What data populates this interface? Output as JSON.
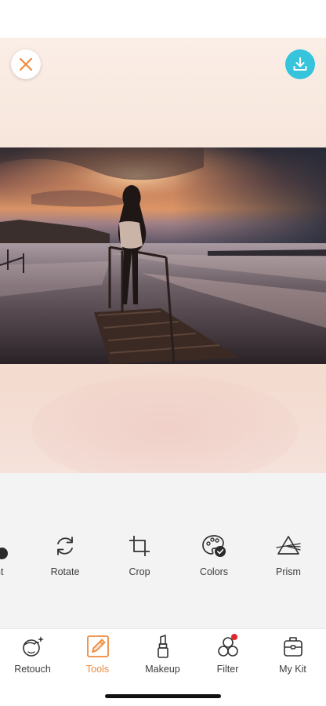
{
  "tools": {
    "partial_label": "nt",
    "items": [
      {
        "label": "Rotate",
        "icon": "rotate-icon"
      },
      {
        "label": "Crop",
        "icon": "crop-icon"
      },
      {
        "label": "Colors",
        "icon": "palette-icon"
      },
      {
        "label": "Prism",
        "icon": "prism-icon"
      }
    ]
  },
  "tabs": [
    {
      "label": "Retouch",
      "icon": "face-sparkle-icon"
    },
    {
      "label": "Tools",
      "icon": "pencil-icon",
      "active": true
    },
    {
      "label": "Makeup",
      "icon": "lipstick-icon"
    },
    {
      "label": "Filter",
      "icon": "filter-circles-icon",
      "notification": true
    },
    {
      "label": "My Kit",
      "icon": "kit-bag-icon"
    }
  ],
  "colors": {
    "accent": "#ef8a3c",
    "download": "#35c4dc",
    "close_icon": "#ef8a3c",
    "notification": "#e3262e"
  }
}
